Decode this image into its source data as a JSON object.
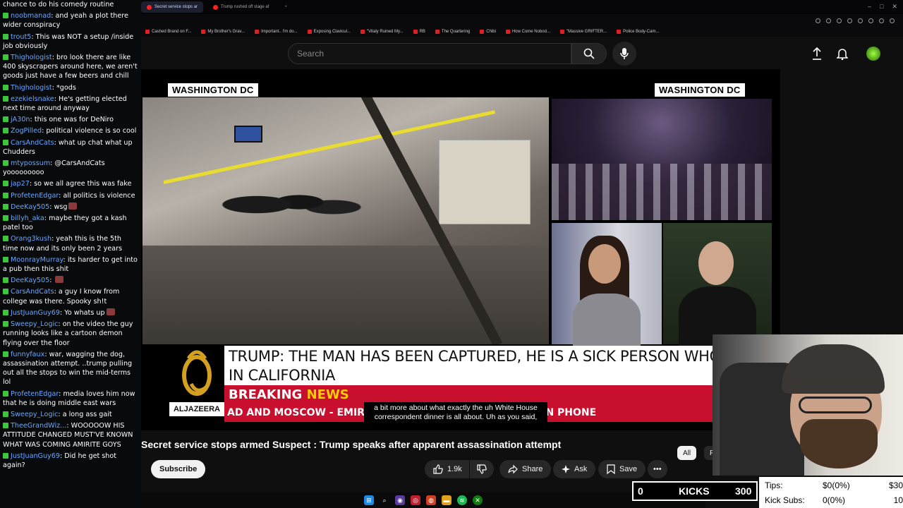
{
  "browser": {
    "tabs": [
      {
        "label": "Secret service stops ar",
        "active": true
      },
      {
        "label": "Trump rushed off stage af",
        "active": false
      }
    ],
    "bookmarks": [
      "Cashed Brand on F...",
      "My Brother's Grav...",
      "Important.. I'm do...",
      "Exposing Clavicul...",
      "\"Vitaly Ruined My...",
      "RB",
      "The Quartering",
      "Chibi",
      "How Come Nobod...",
      "\"Massive GRIFTER...",
      "Police Body-Cam..."
    ]
  },
  "youtube": {
    "search_placeholder": "Search"
  },
  "video": {
    "loc_left": "WASHINGTON DC",
    "loc_right": "WASHINGTON DC",
    "headline": "TRUMP: THE MAN HAS BEEN CAPTURED, HE IS A SICK PERSON WHO LIVES IN CALIFORNIA",
    "breaking": "BREAKING",
    "news": "NEWS",
    "channel_badge": "ALJAZEERA",
    "ticker": "AD AND MOSCOW  -  EMIR OF QATAR                               END IRAN CONFLICT IN PHONE",
    "caption": "a bit more about what exactly the uh White House correspondent dinner is all about. Uh as you said,"
  },
  "page": {
    "title": "Secret service stops armed Suspect : Trump speaks after apparent assassination attempt",
    "subscribe": "Subscribe",
    "likes": "1.9k",
    "share": "Share",
    "ask": "Ask",
    "save": "Save",
    "more": "•••",
    "chip_all": "All",
    "chip_next": "F"
  },
  "chat": [
    {
      "user": "",
      "text": "chance to do his comedy routine"
    },
    {
      "user": "noobmanad",
      "text": "and yeah a plot there wider conspiracy"
    },
    {
      "user": "trout5",
      "text": "This was NOT a setup /inside job obviously"
    },
    {
      "user": "Thighologist",
      "text": "bro look there are like 400 skyscrapers around here, we aren't goods just have a few beers and chill"
    },
    {
      "user": "Thighologist",
      "text": "*gods"
    },
    {
      "user": "ezekielsnake",
      "text": "He's getting elected next time around anyway"
    },
    {
      "user": "jA30n",
      "text": "this one was for DeNiro"
    },
    {
      "user": "ZogPilled",
      "text": "political violence is so cool"
    },
    {
      "user": "CarsAndCats",
      "text": "what up chat what up Chudders"
    },
    {
      "user": "mtypossum",
      "text": "@CarsAndCats yooooooooo"
    },
    {
      "user": "jap27",
      "text": "so we all agree this was fake"
    },
    {
      "user": "ProfetenEdgar",
      "text": "all politics is violence"
    },
    {
      "user": "DeeKay505",
      "text": "wsg"
    },
    {
      "user": "billyh_aka",
      "text": "maybe they got a kash patel too"
    },
    {
      "user": "Orang3kush",
      "text": "yeah this is the 5th time now and its only been 2 years"
    },
    {
      "user": "MoonrayMurray",
      "text": "its harder to get into a pub then this shit"
    },
    {
      "user": "DeeKay505",
      "text": ""
    },
    {
      "user": "CarsAndCats",
      "text": "a guy I know from college was there. Spooky sh!t"
    },
    {
      "user": "JustJuanGuy69",
      "text": "Yo whats up"
    },
    {
      "user": "Sweepy_Logic",
      "text": "on the video the guy running looks like a cartoon demon flying over the floor"
    },
    {
      "user": "funnyfaux",
      "text": "war, wagging the dog, assassination attempt. ..trump pulling out all the stops to win the mid-terms lol"
    },
    {
      "user": "ProfetenEdgar",
      "text": "media loves him now that he is doing middle east wars"
    },
    {
      "user": "Sweepy_Logic",
      "text": "a long ass gait"
    },
    {
      "user": "TheeGrandWiz...",
      "text": "WOOOOOW HIS ATTITUDE CHANGED MUST'VE KNOWN WHAT WAS COMING AMIRITE GOYS"
    },
    {
      "user": "JustJuanGuy69",
      "text": "Did he get shot again?"
    }
  ],
  "overlay": {
    "kicks_count": "0",
    "kicks_label": "KICKS",
    "kicks_goal": "300",
    "tips_label": "Tips:",
    "tips_value": "$0(0%)",
    "tips_goal": "$30",
    "subs_label": "Kick Subs:",
    "subs_value": "0(0%)",
    "subs_goal": "10"
  }
}
